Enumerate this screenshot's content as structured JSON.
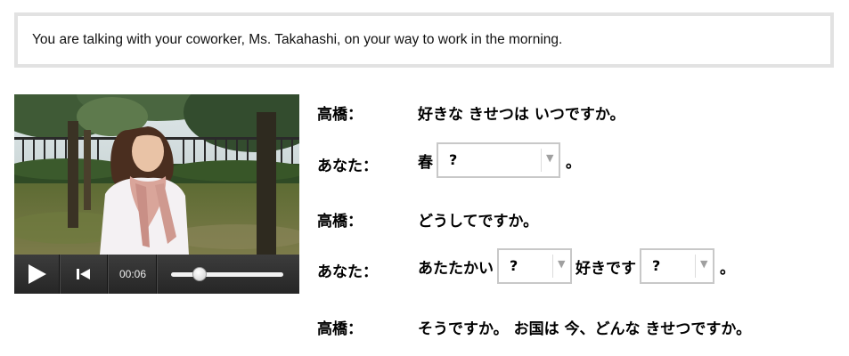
{
  "instruction": "You are talking with your coworker, Ms. Takahashi, on your way to work in the morning.",
  "video": {
    "time": "00:06",
    "progress": 0.25
  },
  "dialogue": {
    "line1": {
      "speaker": "高橋：",
      "text": "好きな きせつは いつですか。"
    },
    "line2": {
      "speaker": "あなた：",
      "prefix": "春",
      "select_value": "?",
      "suffix": "。"
    },
    "line3": {
      "speaker": "高橋：",
      "text": "どうしてですか。"
    },
    "line4": {
      "speaker": "あなた：",
      "prefix": "あたたかい",
      "select1_value": "?",
      "middle": "好きです",
      "select2_value": "?",
      "suffix": "。"
    },
    "line5": {
      "speaker": "高橋：",
      "text": "そうですか。 お国は 今、どんな きせつですか。"
    }
  }
}
